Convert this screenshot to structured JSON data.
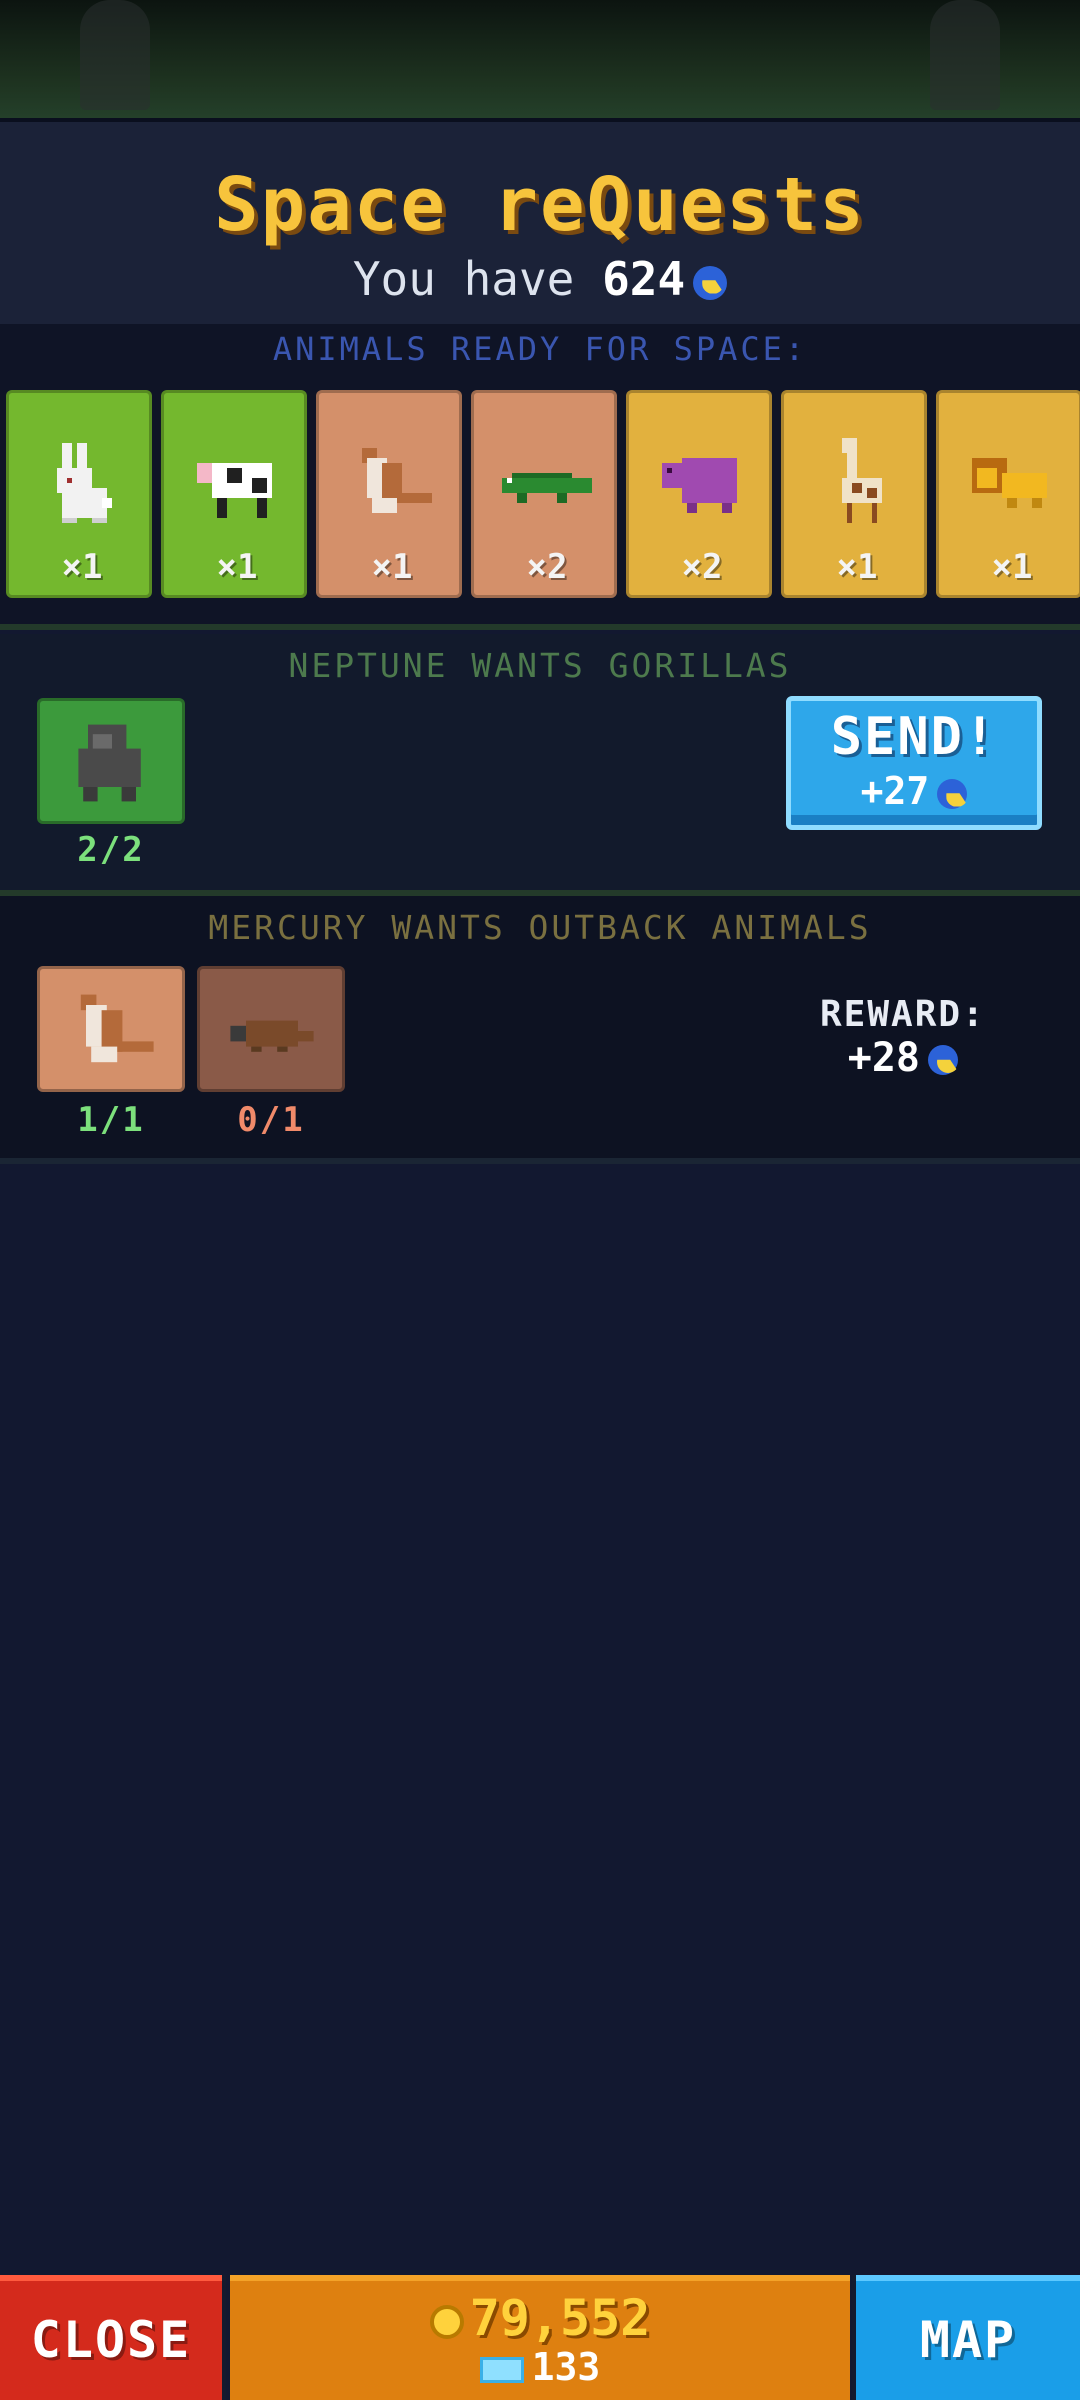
{
  "header": {
    "title": "Space reQuests",
    "have_prefix": "You have",
    "have_amount": "624"
  },
  "ready": {
    "label": "ANIMALS READY FOR SPACE:",
    "cards": [
      {
        "animal": "rabbit",
        "count": "×1",
        "color": "green"
      },
      {
        "animal": "cow",
        "count": "×1",
        "color": "green"
      },
      {
        "animal": "kangaroo",
        "count": "×1",
        "color": "clay"
      },
      {
        "animal": "crocodile",
        "count": "×2",
        "color": "clay"
      },
      {
        "animal": "hippo",
        "count": "×2",
        "color": "gold"
      },
      {
        "animal": "giraffe",
        "count": "×1",
        "color": "gold"
      },
      {
        "animal": "lion",
        "count": "×1",
        "color": "gold"
      }
    ]
  },
  "request1": {
    "label": "NEPTUNE WANTS GORILLAS",
    "slots": [
      {
        "animal": "gorilla",
        "progress": "2/2"
      }
    ],
    "send_label": "SEND!",
    "send_reward": "+27"
  },
  "request2": {
    "label": "MERCURY WANTS OUTBACK ANIMALS",
    "slots": [
      {
        "animal": "kangaroo",
        "progress": "1/1"
      },
      {
        "animal": "platypus",
        "progress": "0/1"
      }
    ],
    "reward_label": "REWARD:",
    "reward_value": "+28"
  },
  "bottom": {
    "close_label": "CLOSE",
    "coins": "79,552",
    "gems": "133",
    "map_label": "MAP"
  },
  "colors": {
    "title": "#f7c43c",
    "card_green": "#74b82e",
    "card_clay": "#d4906a",
    "card_gold": "#e2b13e",
    "send": "#2ea7ea",
    "close": "#d42a1c",
    "map": "#1a9ee8",
    "currency_bar": "#de8010"
  }
}
